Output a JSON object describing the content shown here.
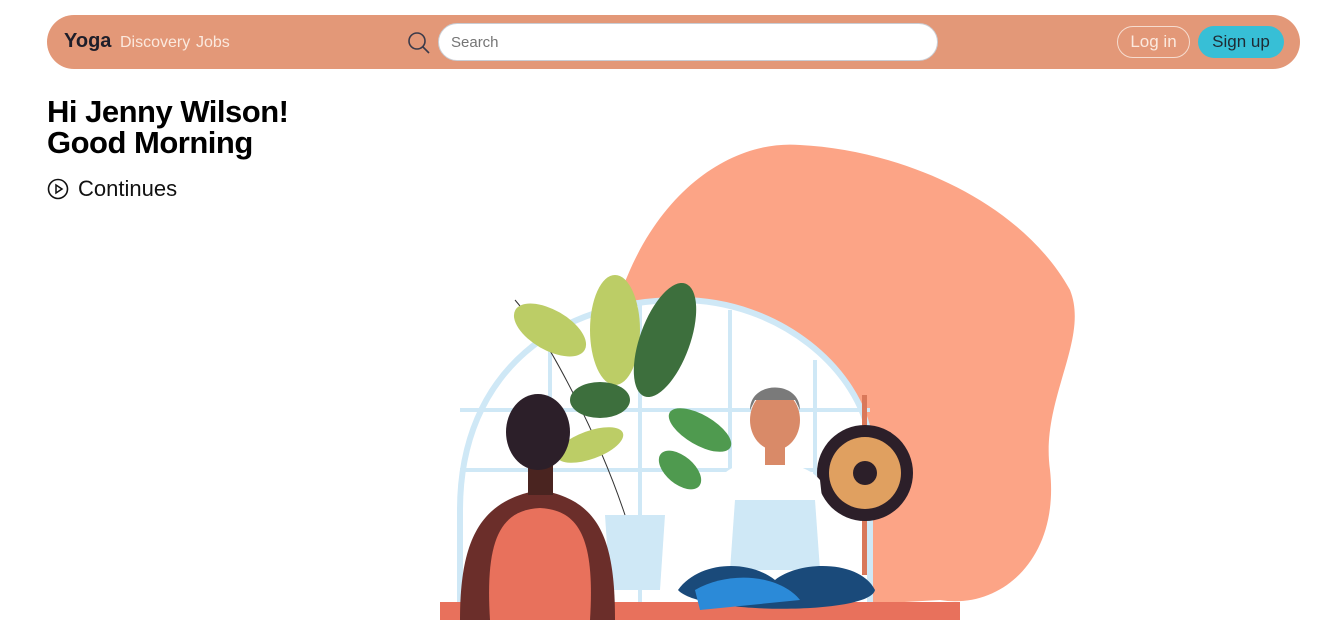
{
  "nav": {
    "brand": "Yoga",
    "links": [
      "Discovery",
      "Jobs"
    ],
    "search_placeholder": "Search",
    "login": "Log in",
    "signup": "Sign up"
  },
  "hero": {
    "greeting_line1": "Hi Jenny Wilson!",
    "greeting_line2": "Good Morning",
    "continue_label": "Continues"
  },
  "colors": {
    "nav_bg": "#e39878",
    "signup_bg": "#37bfd6",
    "blob": "#fca486"
  }
}
